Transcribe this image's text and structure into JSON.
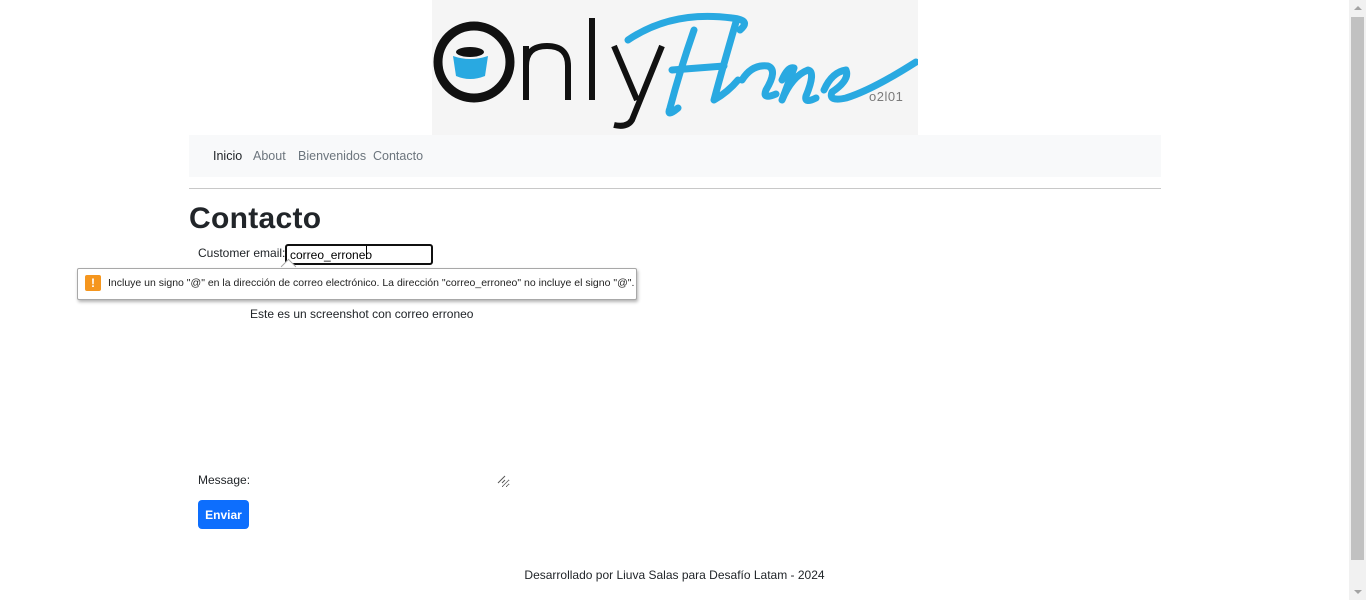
{
  "logo": {
    "wordmark_only": "Only",
    "wordmark_flans": "Flans",
    "sub": "o2l01",
    "colors": {
      "dark": "#111111",
      "accent": "#29a9e1"
    }
  },
  "nav": {
    "items": [
      {
        "label": "Inicio",
        "active": true
      },
      {
        "label": "About",
        "active": false
      },
      {
        "label": "Bienvenidos",
        "active": false
      },
      {
        "label": "Contacto",
        "active": false
      }
    ]
  },
  "page": {
    "title": "Contacto"
  },
  "form": {
    "email_label": "Customer email:",
    "email_value": "correo_erroneo",
    "validation_message": "Incluye un signo \"@\" en la dirección de correo electrónico. La dirección \"correo_erroneo\" no incluye el signo \"@\".",
    "validation_icon": "warning-icon",
    "note": "Este es un screenshot con correo erroneo",
    "message_label": "Message:",
    "submit_label": "Enviar",
    "submit_color": "#0d6efd"
  },
  "footer": {
    "text": "Desarrollado por Liuva Salas para Desafío Latam - 2024"
  }
}
